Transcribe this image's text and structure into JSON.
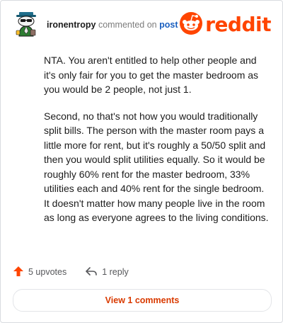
{
  "comment": {
    "author": "ironentropy",
    "action_text": "commented on",
    "post_link": "post",
    "paragraphs": [
      "NTA. You aren't entitled to help other people and it's only fair for you to get the master bedroom as you would be 2 people, not just 1.",
      "Second, no that's not how you would traditionally split bills. The person with the master room pays a little more for rent, but it's roughly a 50/50 split and then you would split utilities equally. So it would be roughly 60% rent for the master bedroom, 33% utilities each and 40% rent for the single bedroom. It doesn't matter how many people live in the room as long as everyone agrees to the living conditions."
    ]
  },
  "brand": {
    "logo_text": "reddit",
    "accent_color": "#ff4500"
  },
  "actions": {
    "upvotes_label": "5 upvotes",
    "reply_label": "1 reply",
    "view_comments_label": "View 1 comments"
  },
  "icons": {
    "avatar": "snoo-avatar-icon",
    "upvote": "upvote-arrow-icon",
    "reply": "reply-arrow-icon",
    "logo": "reddit-snoo-icon"
  }
}
